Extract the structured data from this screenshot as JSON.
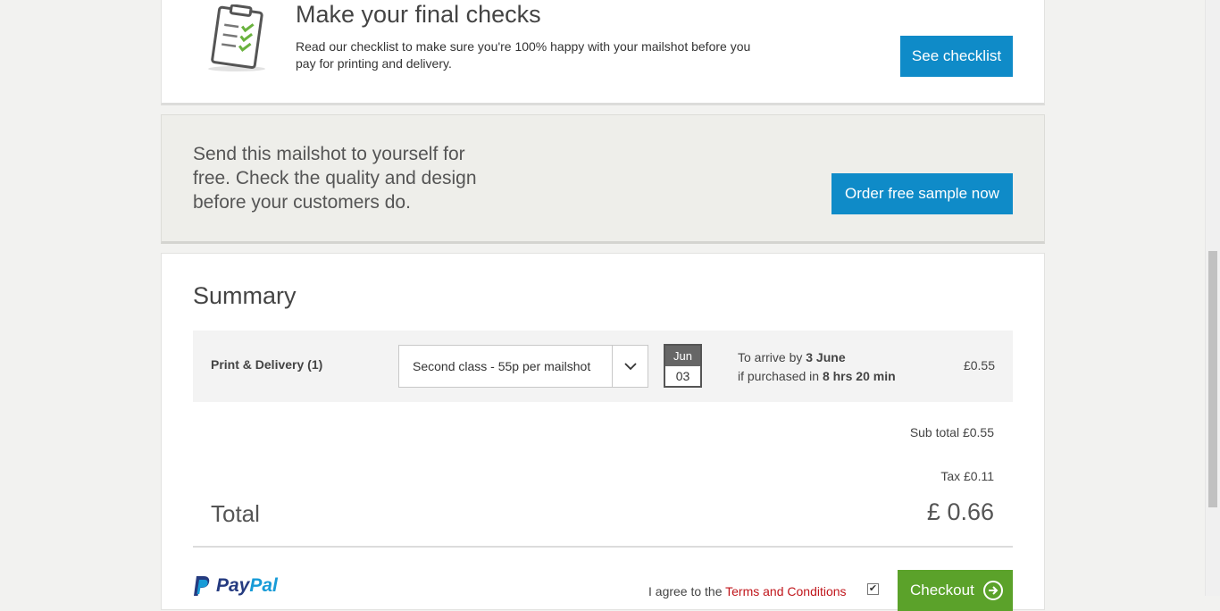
{
  "checks": {
    "title": "Make your final checks",
    "text": "Read our checklist to make sure you're 100% happy with your mailshot before you pay for printing and delivery.",
    "button": "See checklist"
  },
  "sample": {
    "text": "Send this mailshot to yourself for free. Check the quality and design before your customers do.",
    "button": "Order free sample now"
  },
  "summary": {
    "title": "Summary",
    "row": {
      "label": "Print & Delivery (1)",
      "select_value": "Second class - 55p per mailshot",
      "calendar": {
        "month": "Jun",
        "day": "03"
      },
      "arrive_prefix": "To arrive by ",
      "arrive_date": "3 June",
      "purchase_prefix": "if purchased in ",
      "purchase_time": "8 hrs 20 min",
      "price": "£0.55"
    },
    "subtotal": "Sub total £0.55",
    "tax": "Tax £0.11",
    "total_label": "Total",
    "total_value": "£ 0.66"
  },
  "footer": {
    "paypal_first": "Pay",
    "paypal_second": "Pal",
    "agree_prefix": "I agree to the ",
    "terms_link": "Terms and Conditions",
    "checkbox_checked": true,
    "checkout": "Checkout"
  },
  "colors": {
    "accent_blue": "#0f8bc8",
    "checkout_green": "#5ba22a",
    "link_red": "#c0161b"
  }
}
